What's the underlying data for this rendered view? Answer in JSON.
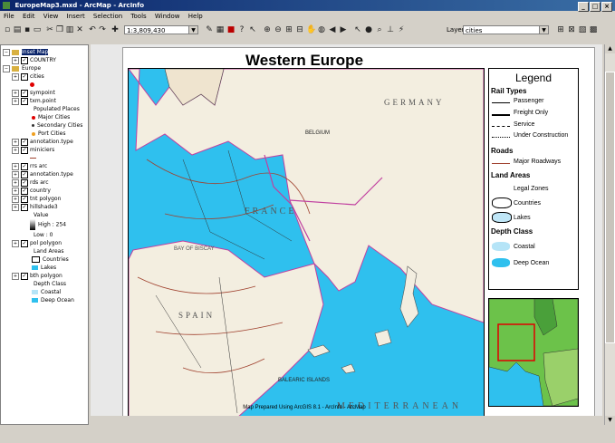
{
  "window": {
    "title": "EuropeMap3.mxd - ArcMap - ArcInfo"
  },
  "menu": [
    "File",
    "Edit",
    "View",
    "Insert",
    "Selection",
    "Tools",
    "Window",
    "Help"
  ],
  "toolbar": {
    "scale_value": "1:3,809,430",
    "layer_label": "Layer:",
    "layer_value": "cities"
  },
  "toc": {
    "items": [
      {
        "label": "Inset Map",
        "kind": "frame",
        "selected": true
      },
      {
        "label": "COUNTRY",
        "kind": "layer"
      },
      {
        "label": "Europe",
        "kind": "frame"
      },
      {
        "label": "cities",
        "kind": "layer"
      },
      {
        "label": "",
        "kind": "symbol-red"
      },
      {
        "label": "sympoint",
        "kind": "layer"
      },
      {
        "label": "txm.point",
        "kind": "layer"
      },
      {
        "label": "Populated Places",
        "kind": "legend"
      },
      {
        "label": "Major Cities",
        "kind": "legend-red"
      },
      {
        "label": "Secondary Cities",
        "kind": "legend-dot"
      },
      {
        "label": "Port Cities",
        "kind": "legend-orange"
      },
      {
        "label": "annotation.type",
        "kind": "layer"
      },
      {
        "label": "miniciers",
        "kind": "layer"
      },
      {
        "label": "",
        "kind": "symbol-line"
      },
      {
        "label": "rrs arc",
        "kind": "layer"
      },
      {
        "label": "annotation.type",
        "kind": "layer"
      },
      {
        "label": "rds arc",
        "kind": "layer"
      },
      {
        "label": "country",
        "kind": "layer"
      },
      {
        "label": "tnt polygon",
        "kind": "layer"
      },
      {
        "label": "hillshade3",
        "kind": "layer"
      },
      {
        "label": "Value",
        "kind": "legend"
      },
      {
        "label": "High : 254",
        "kind": "ramp"
      },
      {
        "label": "Low : 0",
        "kind": "legend"
      },
      {
        "label": "pol polygon",
        "kind": "layer"
      },
      {
        "label": "Land Areas",
        "kind": "legend"
      },
      {
        "label": "Countries",
        "kind": "legend-box"
      },
      {
        "label": "Lakes",
        "kind": "legend-cyan"
      },
      {
        "label": "bth polygon",
        "kind": "layer"
      },
      {
        "label": "Depth Class",
        "kind": "legend"
      },
      {
        "label": "Coastal",
        "kind": "legend-lightblue"
      },
      {
        "label": "Deep Ocean",
        "kind": "legend-cyan"
      }
    ]
  },
  "map": {
    "title": "Western Europe",
    "footer": "Map Prepared Using  ArcGIS 8.1 - ArcInfo - ArcMap",
    "labels": [
      "FRANCE",
      "GERMANY",
      "SPAIN",
      "BALEARIC ISLANDS",
      "MEDITERRANEAN",
      "BAY OF BISCAY",
      "BELGIUM"
    ]
  },
  "legend": {
    "title": "Legend",
    "sections": [
      {
        "heading": "Rail Types",
        "items": [
          "Passenger",
          "Freight Only",
          "Service",
          "Under Construction"
        ]
      },
      {
        "heading": "Roads",
        "items": [
          "Major Roadways"
        ]
      },
      {
        "heading": "Land Areas",
        "items": [
          "Legal Zones",
          "Countries",
          "Lakes"
        ]
      },
      {
        "heading": "Depth Class",
        "items": [
          "Coastal",
          "Deep Ocean"
        ]
      }
    ]
  },
  "colors": {
    "titlebar": "#0a246a",
    "sea": "#2fc0ee",
    "land": "#f3eee0",
    "coastal": "#b5e4f7",
    "country_border": "#c040a0",
    "roads": "#a0422f"
  }
}
